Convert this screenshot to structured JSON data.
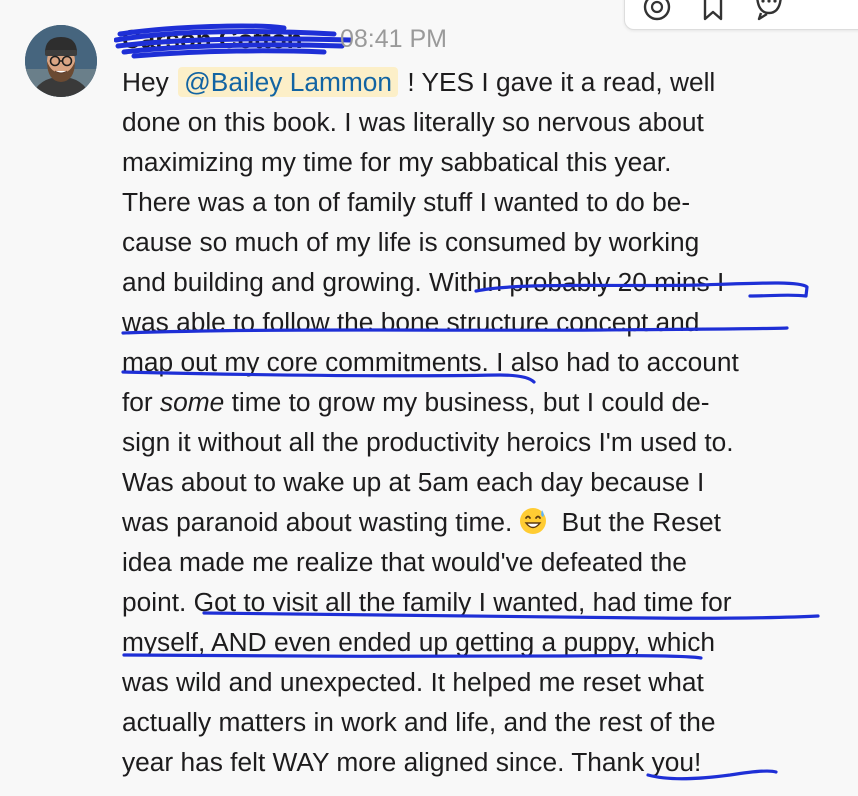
{
  "message": {
    "author": "Carson Cotton",
    "timestamp": "08:41 PM",
    "lines": [
      {
        "text": "Hey "
      },
      {
        "text": "done on this book. I was literally so nervous about"
      },
      {
        "text": "maximizing my time for my sabbatical this year."
      },
      {
        "text": "There was a ton of family stuff I wanted to do be-"
      },
      {
        "text": "cause so much of my life is consumed by working"
      },
      {
        "text": "and building and growing. Within probably 20 mins I"
      },
      {
        "text": "was able to follow the bone structure concept and"
      },
      {
        "text": "map out my core commitments. I also had to account"
      },
      {
        "text": "for "
      },
      {
        "text": "sign it without all the productivity heroics I'm used to."
      },
      {
        "text": "Was about to wake up at 5am each day because I"
      },
      {
        "text": "was paranoid about wasting time."
      },
      {
        "text": "idea made me realize that would've defeated the"
      },
      {
        "text": "point. Got to visit all the family I wanted, had time for"
      },
      {
        "text": "myself, AND even ended up getting a puppy, which"
      },
      {
        "text": "was wild and unexpected. It helped me reset what"
      },
      {
        "text": "actually matters in work and life, and the rest of the"
      },
      {
        "text": "year has felt WAY more aligned since. Thank you!"
      }
    ],
    "mention": "@Bailey Lammon",
    "after_mention": " ! YES I gave it a read, well",
    "italic_word": "some",
    "after_italic": " time to grow my business, but I could de-",
    "after_emoji": " But the Reset",
    "emoji": "grinning-face-with-sweat"
  },
  "toolbar": {
    "icons": [
      "emoji-reaction-icon",
      "bookmark-icon",
      "reply-in-thread-icon",
      "more-actions-icon"
    ]
  },
  "colors": {
    "mention_text": "#1264a3",
    "mention_bg": "#fcefc8",
    "annotation_pen": "#1e2fd6",
    "timestamp": "#9a9a9a",
    "background": "#f8f8f8"
  }
}
